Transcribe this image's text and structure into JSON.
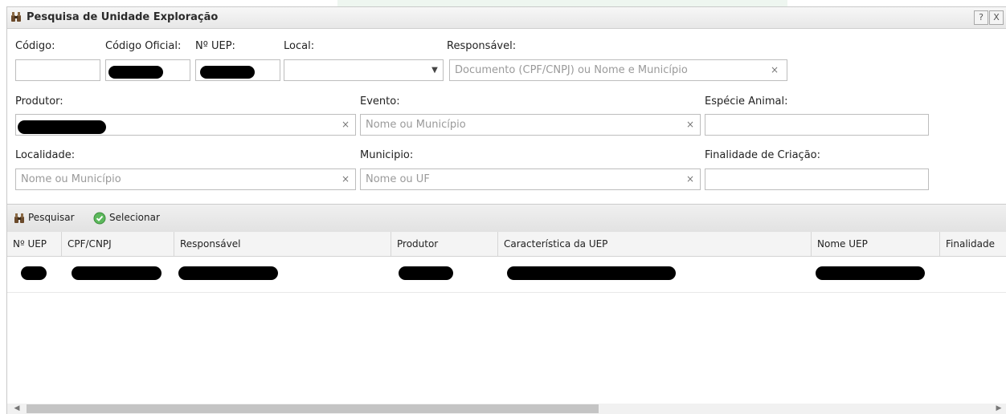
{
  "window": {
    "title": "Pesquisa de Unidade Exploração",
    "help_label": "?",
    "close_label": "X"
  },
  "form": {
    "codigo_label": "Código:",
    "codigo_oficial_label": "Código Oficial:",
    "num_uep_label": "Nº UEP:",
    "local_label": "Local:",
    "local_value": "",
    "responsavel_label": "Responsável:",
    "responsavel_placeholder": "Documento (CPF/CNPJ) ou Nome e Município",
    "produtor_label": "Produtor:",
    "evento_label": "Evento:",
    "evento_placeholder": "Nome ou Município",
    "especie_label": "Espécie Animal:",
    "localidade_label": "Localidade:",
    "localidade_placeholder": "Nome ou Município",
    "municipio_label": "Municipio:",
    "municipio_placeholder": "Nome ou UF",
    "finalidade_label": "Finalidade de Criação:",
    "clear_symbol": "×",
    "dropdown_symbol": "▼"
  },
  "toolbar": {
    "pesquisar_label": "Pesquisar",
    "selecionar_label": "Selecionar"
  },
  "grid": {
    "columns": [
      "Nº UEP",
      "CPF/CNPJ",
      "Responsável",
      "Produtor",
      "Característica da UEP",
      "Nome UEP",
      "Finalidade"
    ]
  },
  "scrollbar": {
    "left_arrow": "◀",
    "right_arrow": "▶"
  },
  "colors": {
    "select_check": "#5cb85c",
    "redaction": "#000000"
  },
  "icons": {
    "title_icon": "binoculars-icon",
    "pesquisar_icon": "binoculars-icon",
    "selecionar_icon": "check-circle-icon"
  }
}
